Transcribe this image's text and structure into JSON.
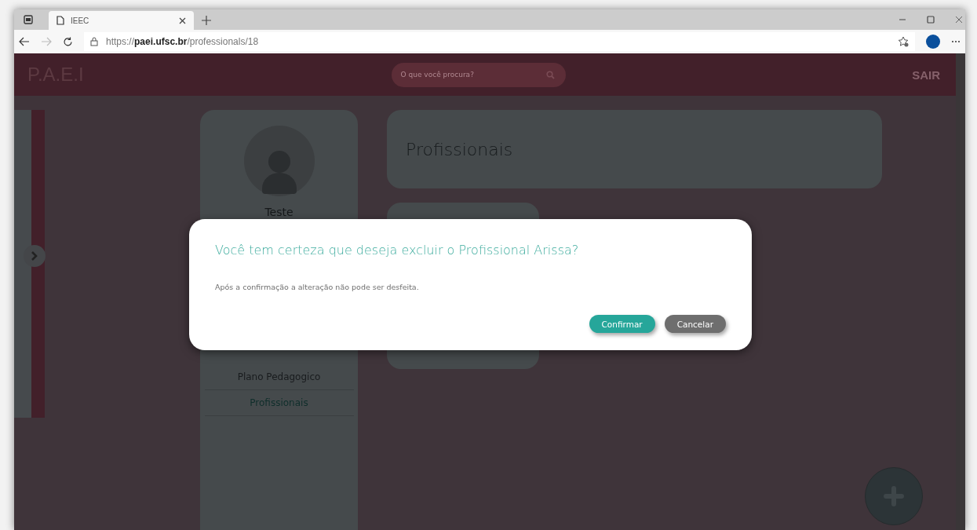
{
  "browser": {
    "tab_title": "IEEC",
    "url": "https://**paei.ufsc.br**/professionals/18"
  },
  "header": {
    "logo": "P.A.E.I",
    "search": {
      "placeholder": "O que você procura?"
    },
    "logout": "SAIR"
  },
  "sidebar": {
    "user_name": "Teste",
    "menu": [
      {
        "label": "Plano Pedagogico"
      },
      {
        "label": "Profissionais"
      }
    ]
  },
  "page_title": "Profissionais",
  "dialog": {
    "title": "Você tem certeza que deseja excluir o Profissional Arissa?",
    "message": "Após a confirmação a alteração não pode ser desfeita.",
    "buttons": [
      {
        "label": "Confirmar",
        "kind": "primary"
      },
      {
        "label": "Cancelar",
        "kind": "secondary"
      }
    ]
  }
}
